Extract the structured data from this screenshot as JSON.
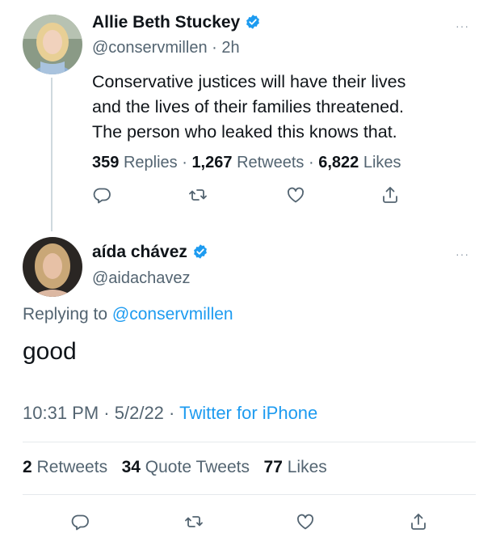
{
  "colors": {
    "accent": "#1d9bf0",
    "muted": "#536471",
    "text": "#0f1419",
    "divider": "#e5e9ec"
  },
  "parent_tweet": {
    "author_name": "Allie Beth Stuckey",
    "handle": "@conservmillen",
    "time_sep": "·",
    "time": "2h",
    "verified_icon": "verified-badge-icon",
    "more_label": "···",
    "text_lines": [
      "Conservative justices will have their lives",
      "and the lives of their families threatened.",
      "The person who leaked this knows that."
    ],
    "stats": {
      "replies_count": "359",
      "replies_label": "Replies",
      "sep1": "·",
      "retweets_count": "1,267",
      "retweets_label": "Retweets",
      "sep2": "·",
      "likes_count": "6,822",
      "likes_label": "Likes"
    },
    "actions": [
      "reply-icon",
      "retweet-icon",
      "like-icon",
      "share-icon"
    ]
  },
  "reply_tweet": {
    "author_name": "aída chávez",
    "handle": "@aidachavez",
    "verified_icon": "verified-badge-icon",
    "more_label": "···",
    "replying_prefix": "Replying to",
    "replying_handle": "@conservmillen",
    "text": "good",
    "meta": {
      "time": "10:31 PM",
      "sep1": "·",
      "date": "5/2/22",
      "sep2": "·",
      "source": "Twitter for iPhone"
    },
    "stats": {
      "retweets_count": "2",
      "retweets_label": "Retweets",
      "quotes_count": "34",
      "quotes_label": "Quote Tweets",
      "likes_count": "77",
      "likes_label": "Likes"
    },
    "actions": [
      "reply-icon",
      "retweet-icon",
      "like-icon",
      "share-icon"
    ]
  }
}
